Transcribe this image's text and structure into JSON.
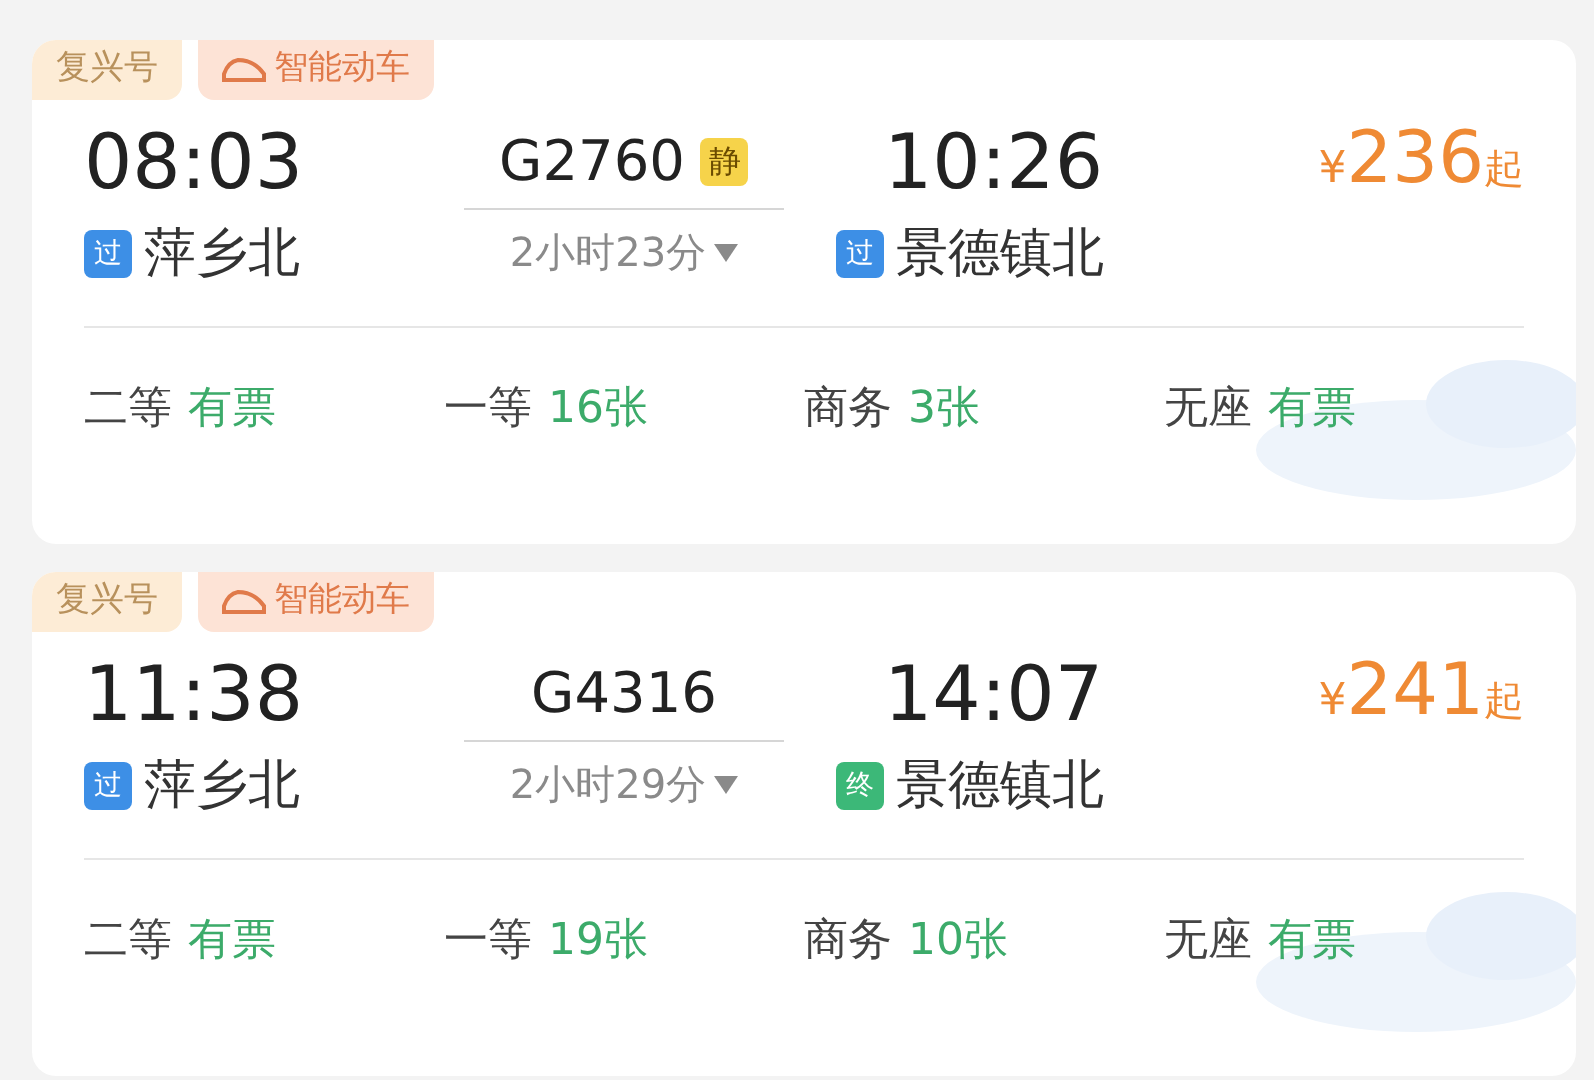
{
  "trains": [
    {
      "tags": [
        "复兴号",
        "智能动车"
      ],
      "depart_time": "08:03",
      "train_no": "G2760",
      "quiet_badge": "静",
      "arrive_time": "10:26",
      "price_symbol": "¥",
      "price": "236",
      "price_suffix": "起",
      "from": {
        "badge": "过",
        "kind": "pass",
        "name": "萍乡北"
      },
      "duration": "2小时23分",
      "to": {
        "badge": "过",
        "kind": "pass",
        "name": "景德镇北"
      },
      "seats": [
        {
          "class": "二等",
          "availability": "有票"
        },
        {
          "class": "一等",
          "availability": "16张"
        },
        {
          "class": "商务",
          "availability": "3张"
        },
        {
          "class": "无座",
          "availability": "有票"
        }
      ]
    },
    {
      "tags": [
        "复兴号",
        "智能动车"
      ],
      "depart_time": "11:38",
      "train_no": "G4316",
      "arrive_time": "14:07",
      "price_symbol": "¥",
      "price": "241",
      "price_suffix": "起",
      "from": {
        "badge": "过",
        "kind": "pass",
        "name": "萍乡北"
      },
      "duration": "2小时29分",
      "to": {
        "badge": "终",
        "kind": "terminal",
        "name": "景德镇北"
      },
      "seats": [
        {
          "class": "二等",
          "availability": "有票"
        },
        {
          "class": "一等",
          "availability": "19张"
        },
        {
          "class": "商务",
          "availability": "10张"
        },
        {
          "class": "无座",
          "availability": "有票"
        }
      ]
    }
  ]
}
